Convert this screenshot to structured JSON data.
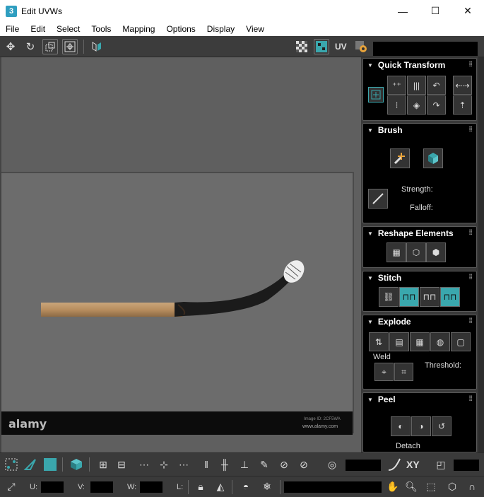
{
  "window": {
    "app_icon": "3",
    "title": "Edit UVWs",
    "minimize": "—",
    "maximize": "☐",
    "close": "✕"
  },
  "menu": [
    "File",
    "Edit",
    "Select",
    "Tools",
    "Mapping",
    "Options",
    "Display",
    "View"
  ],
  "toolbar": {
    "uv_label": "UV"
  },
  "viewport": {
    "watermark_logo": "alamy",
    "watermark_id": "Image ID: 2CF5WA",
    "watermark_url": "www.alamy.com"
  },
  "panels": {
    "quick_transform": {
      "title": "Quick Transform"
    },
    "brush": {
      "title": "Brush",
      "strength_label": "Strength:",
      "falloff_label": "Falloff:"
    },
    "reshape": {
      "title": "Reshape Elements"
    },
    "stitch": {
      "title": "Stitch"
    },
    "explode": {
      "title": "Explode",
      "weld_label": "Weld",
      "threshold_label": "Threshold:"
    },
    "peel": {
      "title": "Peel",
      "detach_label": "Detach"
    }
  },
  "bottom": {
    "xy_label": "XY",
    "u_label": "U:",
    "v_label": "V:",
    "w_label": "W:",
    "l_label": "L:"
  },
  "colors": {
    "accent_teal": "#3aa7ad",
    "panel_bg": "#000000",
    "viewport_bg": "#5f5f5f"
  }
}
